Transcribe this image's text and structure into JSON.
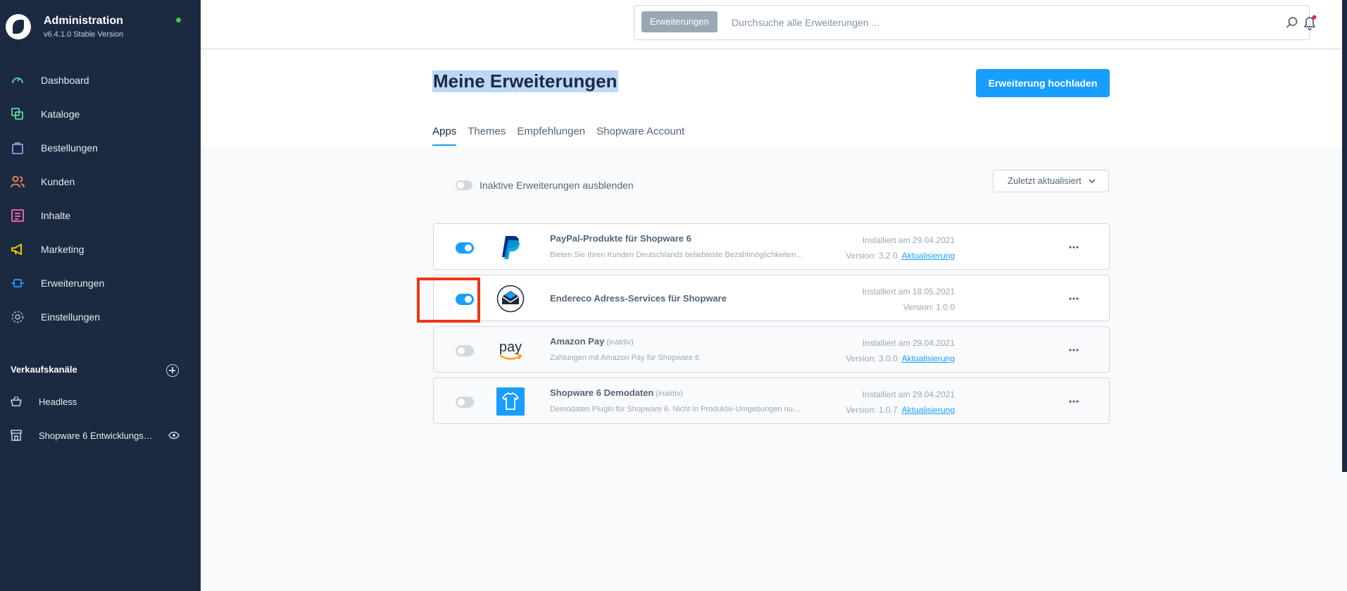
{
  "sidebar": {
    "title": "Administration",
    "version": "v6.4.1.0 Stable Version",
    "nav": [
      {
        "label": "Dashboard",
        "icon": "dashboard-icon",
        "color": "#57d9a3"
      },
      {
        "label": "Kataloge",
        "icon": "catalog-icon",
        "color": "#57d9a3"
      },
      {
        "label": "Bestellungen",
        "icon": "shopping-bag-icon",
        "color": "#a092f0"
      },
      {
        "label": "Kunden",
        "icon": "users-icon",
        "color": "#f88962"
      },
      {
        "label": "Inhalte",
        "icon": "content-icon",
        "color": "#ff68b4"
      },
      {
        "label": "Marketing",
        "icon": "megaphone-icon",
        "color": "#ffd700"
      },
      {
        "label": "Erweiterungen",
        "icon": "plug-icon",
        "color": "#189eff"
      },
      {
        "label": "Einstellungen",
        "icon": "gear-icon",
        "color": "#9aa8b5"
      }
    ],
    "section_title": "Verkaufskanäle",
    "channels": [
      {
        "label": "Headless",
        "icon": "basket-icon"
      },
      {
        "label": "Shopware 6 Entwicklungs…",
        "icon": "storefront-icon"
      }
    ]
  },
  "topbar": {
    "search_chip": "Erweiterungen",
    "search_placeholder": "Durchsuche alle Erweiterungen ..."
  },
  "header": {
    "title": "Meine Erweiterungen",
    "upload_label": "Erweiterung hochladen",
    "tabs": [
      "Apps",
      "Themes",
      "Empfehlungen",
      "Shopware Account"
    ]
  },
  "filter": {
    "label": "Inaktive Erweiterungen ausblenden",
    "sort_label": "Zuletzt aktualisiert"
  },
  "extensions": [
    {
      "name": "PayPal-Produkte für Shopware 6",
      "inactive_label": "",
      "description": "Bieten Sie Ihren Kunden Deutschlands beliebteste Bezahlmöglichkeiten…",
      "installed": "Installiert am 29.04.2021",
      "version": "Version: 3.2.0",
      "update": "Aktualisierung",
      "active": true,
      "logo": "paypal-logo"
    },
    {
      "name": "Endereco Adress-Services für Shopware",
      "inactive_label": "",
      "description": "",
      "installed": "Installiert am 18.05.2021",
      "version": "Version: 1.0.0",
      "update": "",
      "active": true,
      "logo": "endereco-logo"
    },
    {
      "name": "Amazon Pay",
      "inactive_label": "(inaktiv)",
      "description": "Zahlungen mit Amazon Pay für Shopware 6",
      "installed": "Installiert am 29.04.2021",
      "version": "Version: 3.0.0",
      "update": "Aktualisierung",
      "active": false,
      "logo": "amazon-pay-logo",
      "logo_text": "pay"
    },
    {
      "name": "Shopware 6 Demodaten",
      "inactive_label": "(inaktiv)",
      "description": "Demodaten Plugin für Shopware 6. Nicht in Produktiv-Umgebungen nu…",
      "installed": "Installiert am 29.04.2021",
      "version": "Version: 1.0.7",
      "update": "Aktualisierung",
      "active": false,
      "logo": "tshirt-logo"
    }
  ],
  "colors": {
    "sidebar_bg": "#1b2a41",
    "accent": "#189eff",
    "highlight": "#ee3514"
  }
}
